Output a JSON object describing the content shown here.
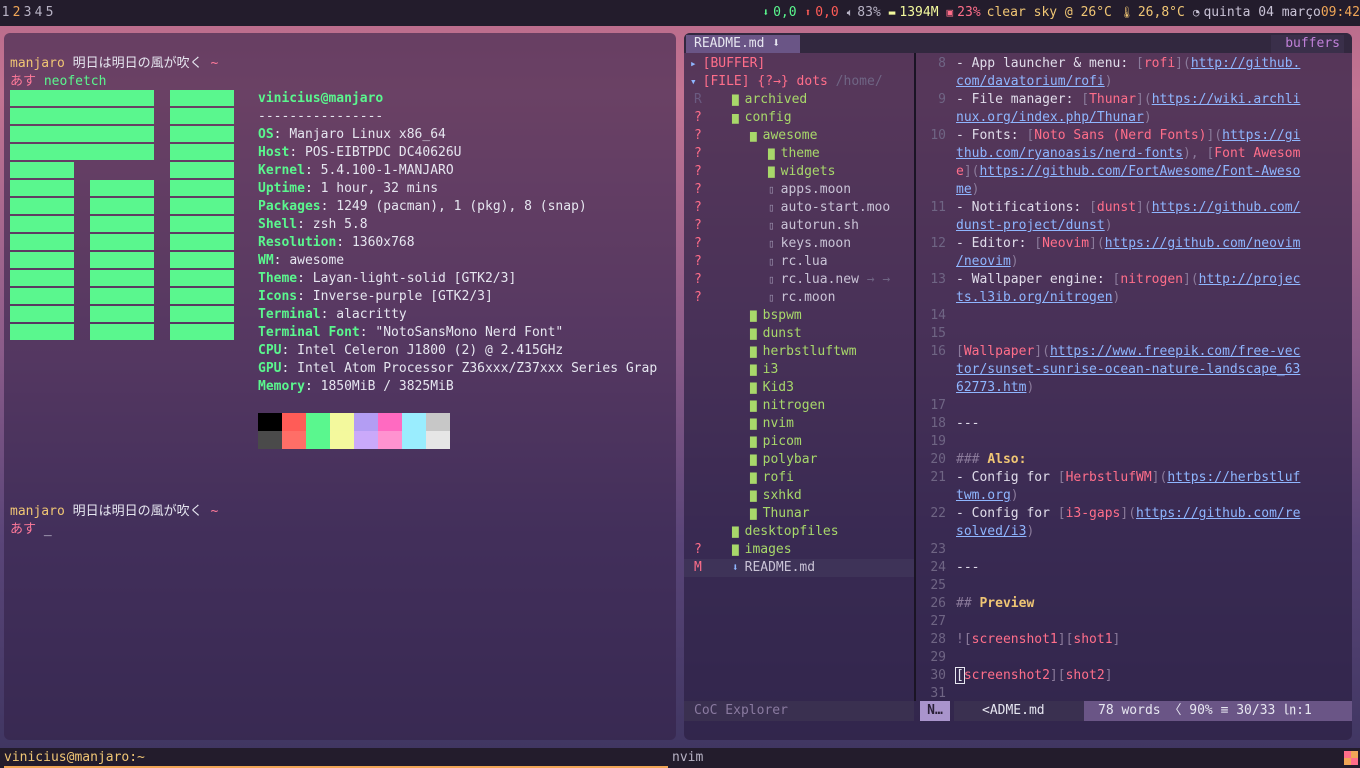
{
  "topbar": {
    "tags": [
      "1",
      "2",
      "3",
      "4",
      "5"
    ],
    "active_tag": "2",
    "net_down": "0,0",
    "net_up": "0,0",
    "volume": "83%",
    "memory": "1394M",
    "cpu": "23%",
    "weather": "clear sky @ 26°C",
    "temp": "26,8°C",
    "date": "quinta 04 março",
    "time": "09:42",
    "colors": {
      "down": "#5af78e",
      "up": "#ff5c57",
      "vol": "#b7b2c4",
      "mem": "#f3f99d",
      "cpu": "#ff6e8a",
      "weather": "#f0c674",
      "temp": "#f0c674",
      "date": "#c9c3d6",
      "time": "#f0a657"
    }
  },
  "terminal": {
    "prompt_host": "manjaro",
    "prompt_jp": " 明日は明日の風が吹く ",
    "prompt_tilde": "~",
    "prompt_asu": "あす",
    "command": " neofetch",
    "cursor": "_",
    "user_host": "vinicius@manjaro",
    "divider": "----------------",
    "info": [
      {
        "k": "OS",
        "v": "Manjaro Linux x86_64"
      },
      {
        "k": "Host",
        "v": "POS-EIBTPDC DC40626U"
      },
      {
        "k": "Kernel",
        "v": "5.4.100-1-MANJARO"
      },
      {
        "k": "Uptime",
        "v": "1 hour, 32 mins"
      },
      {
        "k": "Packages",
        "v": "1249 (pacman), 1 (pkg), 8 (snap)"
      },
      {
        "k": "Shell",
        "v": "zsh 5.8"
      },
      {
        "k": "Resolution",
        "v": "1360x768"
      },
      {
        "k": "WM",
        "v": "awesome"
      },
      {
        "k": "Theme",
        "v": "Layan-light-solid [GTK2/3]"
      },
      {
        "k": "Icons",
        "v": "Inverse-purple [GTK2/3]"
      },
      {
        "k": "Terminal",
        "v": "alacritty"
      },
      {
        "k": "Terminal Font",
        "v": "\"NotoSansMono Nerd Font\""
      },
      {
        "k": "CPU",
        "v": "Intel Celeron J1800 (2) @ 2.415GHz"
      },
      {
        "k": "GPU",
        "v": "Intel Atom Processor Z36xxx/Z37xxx Series Grap"
      },
      {
        "k": "Memory",
        "v": "1850MiB / 3825MiB"
      }
    ],
    "palette_row1": [
      "#000000",
      "#ff5c57",
      "#5af78e",
      "#f3f99d",
      "#b39df3",
      "#ff6ac1",
      "#9aedfe",
      "#c7c7c7"
    ],
    "palette_row2": [
      "#4a4a4a",
      "#ff6e67",
      "#5af78e",
      "#f4f99d",
      "#caa9fa",
      "#ff92d0",
      "#9aedfe",
      "#e6e6e6"
    ]
  },
  "nvim": {
    "tab_label": "README.md",
    "tab_icon": "download-icon",
    "buffers_label": "buffers",
    "explorer": [
      {
        "git": "",
        "indent": 0,
        "kind": "root",
        "name": "[BUFFER]"
      },
      {
        "git": "",
        "indent": 0,
        "kind": "root",
        "name": "[FILE] {?→} dots",
        "extra": " /home/"
      },
      {
        "git": "R",
        "indent": 1,
        "kind": "folder",
        "name": "archived"
      },
      {
        "git": "?",
        "indent": 1,
        "kind": "folder-open",
        "name": "config"
      },
      {
        "git": "?",
        "indent": 2,
        "kind": "folder-open",
        "name": "awesome"
      },
      {
        "git": "?",
        "indent": 3,
        "kind": "folder",
        "name": "theme"
      },
      {
        "git": "?",
        "indent": 3,
        "kind": "folder",
        "name": "widgets"
      },
      {
        "git": "?",
        "indent": 3,
        "kind": "file",
        "name": "apps.moon"
      },
      {
        "git": "?",
        "indent": 3,
        "kind": "file",
        "name": "auto-start.moo"
      },
      {
        "git": "?",
        "indent": 3,
        "kind": "file",
        "name": "autorun.sh"
      },
      {
        "git": "?",
        "indent": 3,
        "kind": "file",
        "name": "keys.moon"
      },
      {
        "git": "?",
        "indent": 3,
        "kind": "file",
        "name": "rc.lua"
      },
      {
        "git": "?",
        "indent": 3,
        "kind": "file",
        "name": "rc.lua.new",
        "extra": " → →"
      },
      {
        "git": "?",
        "indent": 3,
        "kind": "file",
        "name": "rc.moon"
      },
      {
        "git": "",
        "indent": 2,
        "kind": "folder",
        "name": "bspwm"
      },
      {
        "git": "",
        "indent": 2,
        "kind": "folder",
        "name": "dunst"
      },
      {
        "git": "",
        "indent": 2,
        "kind": "folder",
        "name": "herbstluftwm"
      },
      {
        "git": "",
        "indent": 2,
        "kind": "folder",
        "name": "i3"
      },
      {
        "git": "",
        "indent": 2,
        "kind": "folder",
        "name": "Kid3"
      },
      {
        "git": "",
        "indent": 2,
        "kind": "folder",
        "name": "nitrogen"
      },
      {
        "git": "",
        "indent": 2,
        "kind": "folder",
        "name": "nvim"
      },
      {
        "git": "",
        "indent": 2,
        "kind": "folder",
        "name": "picom"
      },
      {
        "git": "",
        "indent": 2,
        "kind": "folder",
        "name": "polybar"
      },
      {
        "git": "",
        "indent": 2,
        "kind": "folder",
        "name": "rofi"
      },
      {
        "git": "",
        "indent": 2,
        "kind": "folder",
        "name": "sxhkd"
      },
      {
        "git": "",
        "indent": 2,
        "kind": "folder",
        "name": "Thunar"
      },
      {
        "git": "",
        "indent": 1,
        "kind": "folder",
        "name": "desktopfiles"
      },
      {
        "git": "?",
        "indent": 1,
        "kind": "folder",
        "name": "images"
      },
      {
        "git": "M",
        "indent": 1,
        "kind": "readme",
        "name": "README.md"
      }
    ],
    "editor_lines": [
      {
        "n": "8",
        "segs": [
          [
            "t",
            "- App launcher & menu: "
          ],
          [
            "br",
            "["
          ],
          [
            "lk",
            "rofi"
          ],
          [
            "br",
            "]("
          ],
          [
            "url",
            "http://github."
          ]
        ]
      },
      {
        "n": "",
        "segs": [
          [
            "url",
            "com/davatorium/rofi"
          ],
          [
            "br",
            ")"
          ]
        ]
      },
      {
        "n": "9",
        "segs": [
          [
            "t",
            "- File manager: "
          ],
          [
            "br",
            "["
          ],
          [
            "lk",
            "Thunar"
          ],
          [
            "br",
            "]("
          ],
          [
            "url",
            "https://wiki.archli"
          ]
        ]
      },
      {
        "n": "",
        "segs": [
          [
            "url",
            "nux.org/index.php/Thunar"
          ],
          [
            "br",
            ")"
          ]
        ]
      },
      {
        "n": "10",
        "segs": [
          [
            "t",
            "- Fonts: "
          ],
          [
            "br",
            "["
          ],
          [
            "lk",
            "Noto Sans (Nerd Fonts)"
          ],
          [
            "br",
            "]("
          ],
          [
            "url",
            "https://gi"
          ]
        ]
      },
      {
        "n": "",
        "segs": [
          [
            "url",
            "thub.com/ryanoasis/nerd-fonts"
          ],
          [
            "br",
            "), "
          ],
          [
            "br",
            "["
          ],
          [
            "lk",
            "Font Awesom"
          ]
        ]
      },
      {
        "n": "",
        "segs": [
          [
            "lk",
            "e"
          ],
          [
            "br",
            "]("
          ],
          [
            "url",
            "https://github.com/FortAwesome/Font-Aweso"
          ]
        ]
      },
      {
        "n": "",
        "segs": [
          [
            "url",
            "me"
          ],
          [
            "br",
            ")"
          ]
        ]
      },
      {
        "n": "11",
        "segs": [
          [
            "t",
            "- Notifications: "
          ],
          [
            "br",
            "["
          ],
          [
            "lk",
            "dunst"
          ],
          [
            "br",
            "]("
          ],
          [
            "url",
            "https://github.com/"
          ]
        ]
      },
      {
        "n": "",
        "segs": [
          [
            "url",
            "dunst-project/dunst"
          ],
          [
            "br",
            ")"
          ]
        ]
      },
      {
        "n": "12",
        "segs": [
          [
            "t",
            "- Editor: "
          ],
          [
            "br",
            "["
          ],
          [
            "lk",
            "Neovim"
          ],
          [
            "br",
            "]("
          ],
          [
            "url",
            "https://github.com/neovim"
          ]
        ]
      },
      {
        "n": "",
        "segs": [
          [
            "url",
            "/neovim"
          ],
          [
            "br",
            ")"
          ]
        ]
      },
      {
        "n": "13",
        "segs": [
          [
            "t",
            "- Wallpaper engine: "
          ],
          [
            "br",
            "["
          ],
          [
            "lk",
            "nitrogen"
          ],
          [
            "br",
            "]("
          ],
          [
            "url",
            "http://projec"
          ]
        ]
      },
      {
        "n": "",
        "segs": [
          [
            "url",
            "ts.l3ib.org/nitrogen"
          ],
          [
            "br",
            ")"
          ]
        ]
      },
      {
        "n": "14",
        "segs": []
      },
      {
        "n": "15",
        "segs": []
      },
      {
        "n": "16",
        "segs": [
          [
            "br",
            "["
          ],
          [
            "lk",
            "Wallpaper"
          ],
          [
            "br",
            "]("
          ],
          [
            "url",
            "https://www.freepik.com/free-vec"
          ]
        ]
      },
      {
        "n": "",
        "segs": [
          [
            "url",
            "tor/sunset-sunrise-ocean-nature-landscape_63"
          ]
        ]
      },
      {
        "n": "",
        "segs": [
          [
            "url",
            "62773.htm"
          ],
          [
            "br",
            ")"
          ]
        ]
      },
      {
        "n": "17",
        "segs": []
      },
      {
        "n": "18",
        "segs": [
          [
            "t",
            "---"
          ]
        ]
      },
      {
        "n": "19",
        "segs": []
      },
      {
        "n": "20",
        "segs": [
          [
            "hm",
            "### "
          ],
          [
            "hd",
            "Also:"
          ]
        ]
      },
      {
        "n": "21",
        "segs": [
          [
            "t",
            "- Config for "
          ],
          [
            "br",
            "["
          ],
          [
            "lk",
            "HerbstlufWM"
          ],
          [
            "br",
            "]("
          ],
          [
            "url",
            "https://herbstluf"
          ]
        ]
      },
      {
        "n": "",
        "segs": [
          [
            "url",
            "twm.org"
          ],
          [
            "br",
            ")"
          ]
        ]
      },
      {
        "n": "22",
        "segs": [
          [
            "t",
            "- Config for "
          ],
          [
            "br",
            "["
          ],
          [
            "lk",
            "i3-gaps"
          ],
          [
            "br",
            "]("
          ],
          [
            "url",
            "https://github.com/re"
          ]
        ]
      },
      {
        "n": "",
        "segs": [
          [
            "url",
            "solved/i3"
          ],
          [
            "br",
            ")"
          ]
        ]
      },
      {
        "n": "23",
        "segs": []
      },
      {
        "n": "24",
        "segs": [
          [
            "t",
            "---"
          ]
        ]
      },
      {
        "n": "25",
        "segs": []
      },
      {
        "n": "26",
        "segs": [
          [
            "hm",
            "## "
          ],
          [
            "hd",
            "Preview"
          ]
        ]
      },
      {
        "n": "27",
        "segs": []
      },
      {
        "n": "28",
        "segs": [
          [
            "br",
            "!["
          ],
          [
            "lk",
            "screenshot1"
          ],
          [
            "br",
            "]["
          ],
          [
            "lk",
            "shot1"
          ],
          [
            "br",
            "]"
          ]
        ]
      },
      {
        "n": "29",
        "segs": []
      },
      {
        "n": "30",
        "segs": [
          [
            "cur",
            "["
          ],
          [
            "lk",
            "screenshot2"
          ],
          [
            "br",
            "]["
          ],
          [
            "lk",
            "shot2"
          ],
          [
            "br",
            "]"
          ]
        ]
      },
      {
        "n": "31",
        "segs": []
      }
    ],
    "status_left": "CoC Explorer",
    "mode": "N…",
    "filename": "<ADME.md",
    "status_right": "78 words 〈 90% ≡ 30/33 ㏑:1"
  },
  "bottombar": {
    "term_title": "vinicius@manjaro:~",
    "nvim_title": "nvim"
  }
}
